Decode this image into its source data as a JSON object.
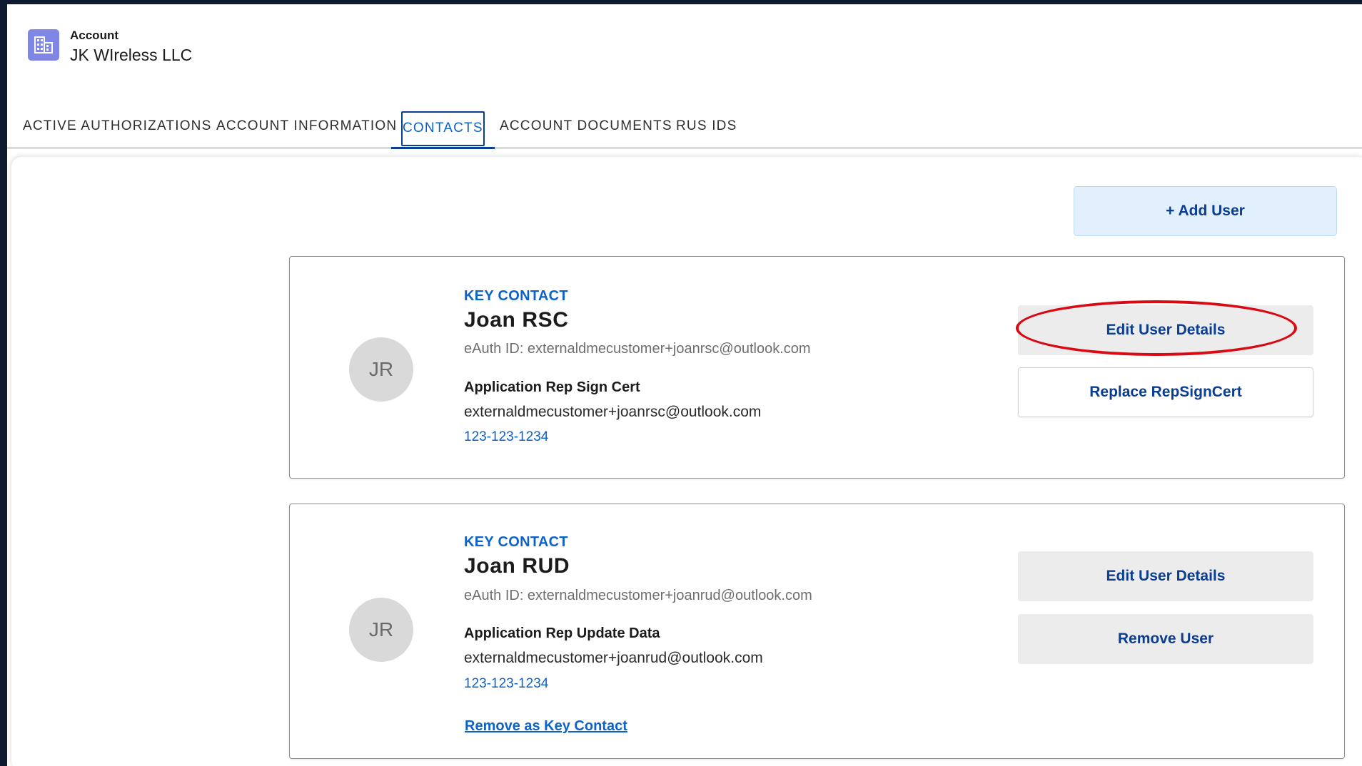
{
  "header": {
    "eyebrow": "Account",
    "account_name": "JK WIreless LLC",
    "icon": "building-icon"
  },
  "tabs": [
    {
      "label": "ACTIVE AUTHORIZATIONS",
      "active": false
    },
    {
      "label": "ACCOUNT INFORMATION",
      "active": false
    },
    {
      "label": "CONTACTS",
      "active": true
    },
    {
      "label": "ACCOUNT DOCUMENTS",
      "active": false
    },
    {
      "label": "RUS IDS",
      "active": false
    }
  ],
  "toolbar": {
    "add_user_label": "+ Add User"
  },
  "contacts": [
    {
      "initials": "JR",
      "badge": "KEY CONTACT",
      "name": "Joan  RSC",
      "eauth": "eAuth ID: externaldmecustomer+joanrsc@outlook.com",
      "role": "Application Rep Sign Cert",
      "email": "externaldmecustomer+joanrsc@outlook.com",
      "phone": "123-123-1234",
      "primary_action": "Edit User Details",
      "secondary_action": "Replace RepSignCert"
    },
    {
      "initials": "JR",
      "badge": "KEY CONTACT",
      "name": "Joan  RUD",
      "eauth": "eAuth ID: externaldmecustomer+joanrud@outlook.com",
      "role": "Application Rep Update Data",
      "email": "externaldmecustomer+joanrud@outlook.com",
      "phone": "123-123-1234",
      "primary_action": "Edit User Details",
      "secondary_action": "Remove User",
      "link_action": "Remove as Key Contact"
    }
  ],
  "colors": {
    "accent": "#0b62c9",
    "navy": "#0b3d91",
    "icon_bg": "#7f86e6",
    "annotation": "#d90a14"
  }
}
